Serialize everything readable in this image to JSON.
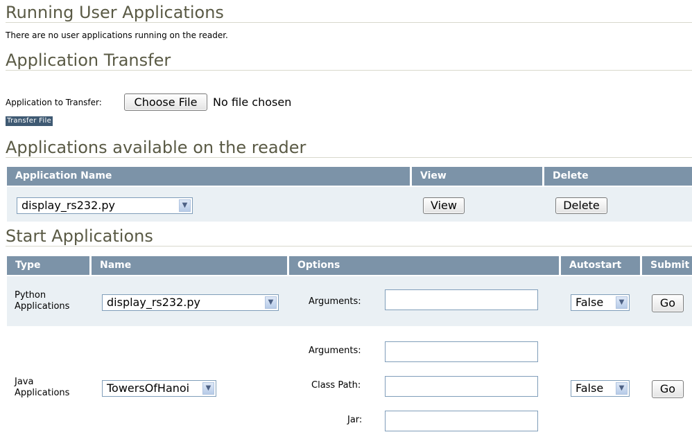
{
  "running": {
    "title": "Running User Applications",
    "message": "There are no user applications running on the reader."
  },
  "transfer": {
    "title": "Application Transfer",
    "label": "Application to Transfer:",
    "choose_button": "Choose File",
    "file_status": "No file chosen",
    "transfer_button": "Transfer File"
  },
  "available": {
    "title": "Applications available on the reader",
    "headers": {
      "name": "Application Name",
      "view": "View",
      "delete": "Delete"
    },
    "selected_app": "display_rs232.py",
    "view_button": "View",
    "delete_button": "Delete"
  },
  "start": {
    "title": "Start Applications",
    "headers": {
      "type": "Type",
      "name": "Name",
      "options": "Options",
      "autostart": "Autostart",
      "submit": "Submit"
    },
    "python": {
      "type_line1": "Python",
      "type_line2": "Applications",
      "selected": "display_rs232.py",
      "arguments_label": "Arguments:",
      "arguments_value": "",
      "autostart": "False",
      "go_button": "Go"
    },
    "java": {
      "type_line1": "Java",
      "type_line2": "Applications",
      "selected": "TowersOfHanoi",
      "arguments_label": "Arguments:",
      "arguments_value": "",
      "classpath_label": "Class Path:",
      "classpath_value": "",
      "jar_label": "Jar:",
      "jar_value": "",
      "autostart": "False",
      "go_button": "Go"
    }
  },
  "colors": {
    "header_bg": "#7c93a8",
    "row_bg": "#eaf0f4",
    "title_text": "#5a5a45",
    "transfer_button_bg": "#3f5a73"
  },
  "icons": {
    "dropdown": "chevron-down-icon"
  }
}
